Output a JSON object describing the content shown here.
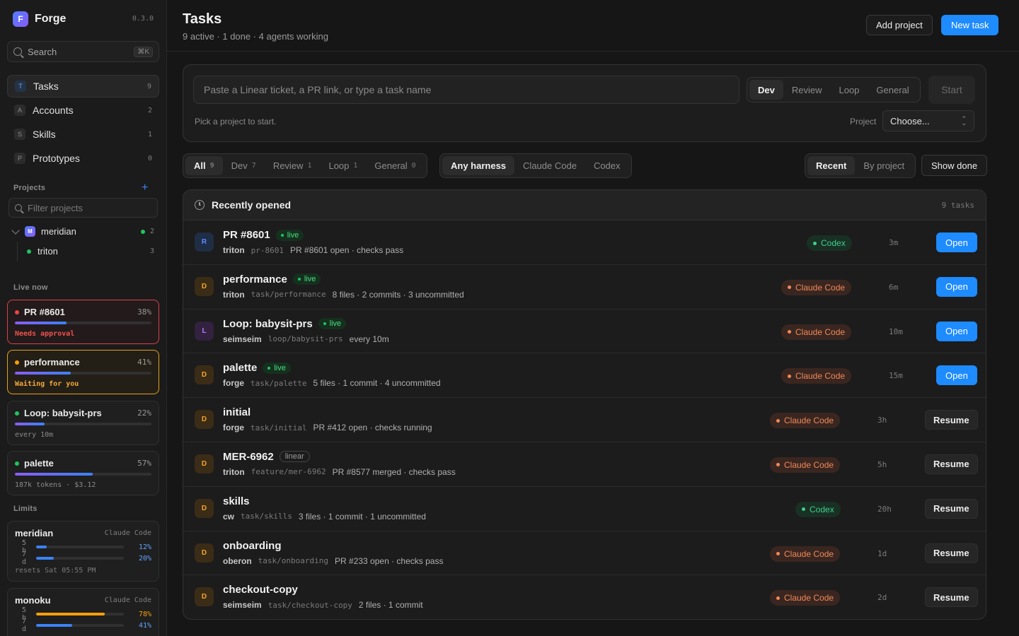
{
  "app": {
    "name": "Forge",
    "logo_letter": "F",
    "version": "0.3.0"
  },
  "sidebar": {
    "search": {
      "label": "Search",
      "shortcut": "⌘K"
    },
    "nav": [
      {
        "letter": "T",
        "label": "Tasks",
        "count": "9",
        "active": true
      },
      {
        "letter": "A",
        "label": "Accounts",
        "count": "2"
      },
      {
        "letter": "S",
        "label": "Skills",
        "count": "1"
      },
      {
        "letter": "P",
        "label": "Prototypes",
        "count": "0"
      }
    ],
    "projects_heading": "Projects",
    "add_project_symbol": "+",
    "filter_placeholder": "Filter projects",
    "projects": [
      {
        "logo_letter": "M",
        "name": "meridian",
        "count": "2"
      },
      {
        "name": "triton",
        "count": "3"
      }
    ],
    "live_heading": "Live now",
    "live": [
      {
        "name": "PR #8601",
        "pct": "38%",
        "progress": 0.38,
        "sub": "Needs approval",
        "state": "red"
      },
      {
        "name": "performance",
        "pct": "41%",
        "progress": 0.41,
        "sub": "Waiting for you",
        "state": "orange"
      },
      {
        "name": "Loop: babysit-prs",
        "pct": "22%",
        "progress": 0.22,
        "sub": "every 10m",
        "state": "normal"
      },
      {
        "name": "palette",
        "pct": "57%",
        "progress": 0.57,
        "sub": "187k tokens · $3.12",
        "state": "normal"
      }
    ],
    "limits_heading": "Limits",
    "limits": [
      {
        "account": "meridian",
        "harness": "Claude Code",
        "rows": [
          {
            "label": "5 h",
            "pct": "12%",
            "value": 0.12
          },
          {
            "label": "7 d",
            "pct": "20%",
            "value": 0.2
          }
        ],
        "reset": "resets Sat 05:55 PM"
      },
      {
        "account": "monoku",
        "harness": "Claude Code",
        "rows": [
          {
            "label": "5 h",
            "pct": "78%",
            "value": 0.78,
            "warn": true
          },
          {
            "label": "7 d",
            "pct": "41%",
            "value": 0.41
          }
        ]
      }
    ]
  },
  "header": {
    "title": "Tasks",
    "subtitle": "9 active · 1 done · 4 agents working",
    "add_project": "Add project",
    "new_task": "New task"
  },
  "composer": {
    "placeholder": "Paste a Linear ticket, a PR link, or type a task name",
    "modes": [
      "Dev",
      "Review",
      "Loop",
      "General"
    ],
    "active_mode": "Dev",
    "start": "Start",
    "hint": "Pick a project to start.",
    "project_label": "Project",
    "project_value": "Choose..."
  },
  "filters": {
    "types": [
      {
        "label": "All",
        "count": "9",
        "active": true
      },
      {
        "label": "Dev",
        "count": "7"
      },
      {
        "label": "Review",
        "count": "1"
      },
      {
        "label": "Loop",
        "count": "1"
      },
      {
        "label": "General",
        "count": "0"
      }
    ],
    "harnesses": [
      {
        "label": "Any harness",
        "active": true
      },
      {
        "label": "Claude Code"
      },
      {
        "label": "Codex"
      }
    ],
    "sort": [
      {
        "label": "Recent",
        "active": true
      },
      {
        "label": "By project"
      }
    ],
    "show_done": "Show done"
  },
  "table": {
    "title": "Recently opened",
    "count": "9 tasks",
    "rows": [
      {
        "avatar": "R",
        "av": "blue",
        "name": "PR #8601",
        "tag": "live",
        "project": "triton",
        "branch": "pr-8601",
        "status": "PR #8601 open · checks pass",
        "harness": "Codex",
        "time": "3m",
        "action": "Open"
      },
      {
        "avatar": "D",
        "av": "orange",
        "name": "performance",
        "tag": "live",
        "project": "triton",
        "branch": "task/performance",
        "status": "8 files · 2 commits · 3 uncommitted",
        "harness": "Claude Code",
        "time": "6m",
        "action": "Open"
      },
      {
        "avatar": "L",
        "av": "purple",
        "name": "Loop: babysit-prs",
        "tag": "live",
        "project": "seimseim",
        "branch": "loop/babysit-prs",
        "status": "every 10m",
        "harness": "Claude Code",
        "time": "10m",
        "action": "Open"
      },
      {
        "avatar": "D",
        "av": "orange",
        "name": "palette",
        "tag": "live",
        "project": "forge",
        "branch": "task/palette",
        "status": "5 files · 1 commit · 4 uncommitted",
        "harness": "Claude Code",
        "time": "15m",
        "action": "Open"
      },
      {
        "avatar": "D",
        "av": "orange",
        "name": "initial",
        "tag": "",
        "project": "forge",
        "branch": "task/initial",
        "status": "PR #412 open · checks running",
        "harness": "Claude Code",
        "time": "3h",
        "action": "Resume"
      },
      {
        "avatar": "D",
        "av": "orange",
        "name": "MER-6962",
        "tag": "linear",
        "project": "triton",
        "branch": "feature/mer-6962",
        "status": "PR #8577 merged · checks pass",
        "harness": "Claude Code",
        "time": "5h",
        "action": "Resume"
      },
      {
        "avatar": "D",
        "av": "orange",
        "name": "skills",
        "tag": "",
        "project": "cw",
        "branch": "task/skills",
        "status": "3 files · 1 commit · 1 uncommitted",
        "harness": "Codex",
        "time": "20h",
        "action": "Resume"
      },
      {
        "avatar": "D",
        "av": "orange",
        "name": "onboarding",
        "tag": "",
        "project": "oberon",
        "branch": "task/onboarding",
        "status": "PR #233 open · checks pass",
        "harness": "Claude Code",
        "time": "1d",
        "action": "Resume"
      },
      {
        "avatar": "D",
        "av": "orange",
        "name": "checkout-copy",
        "tag": "",
        "project": "seimseim",
        "branch": "task/checkout-copy",
        "status": "2 files · 1 commit",
        "harness": "Claude Code",
        "time": "2d",
        "action": "Resume"
      }
    ]
  },
  "colors": {
    "accent": "#1e8bff",
    "live": "#4ade80",
    "codex": "#3fd08a",
    "claude": "#ee8a5a",
    "danger": "#ef4444",
    "warn": "#f59e0b"
  }
}
